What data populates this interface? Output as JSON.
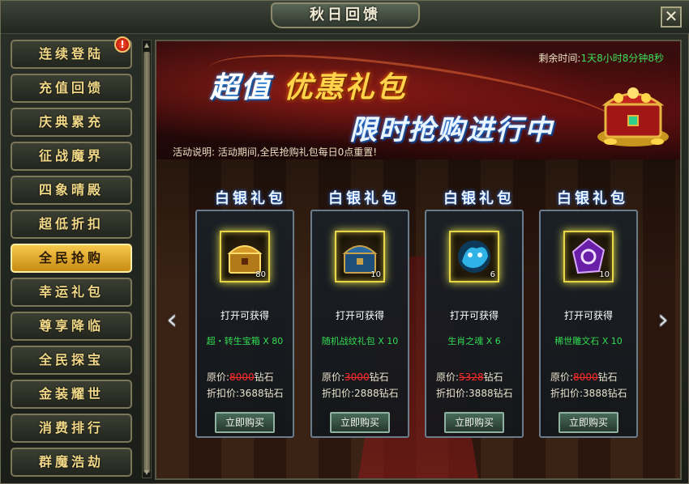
{
  "window": {
    "title": "秋日回馈",
    "close_glyph": "✕"
  },
  "sidebar": {
    "items": [
      {
        "label": "连续登陆",
        "active": false,
        "badge": "!"
      },
      {
        "label": "充值回馈",
        "active": false
      },
      {
        "label": "庆典累充",
        "active": false
      },
      {
        "label": "征战魔界",
        "active": false
      },
      {
        "label": "四象晴殿",
        "active": false
      },
      {
        "label": "超低折扣",
        "active": false
      },
      {
        "label": "全民抢购",
        "active": true
      },
      {
        "label": "幸运礼包",
        "active": false
      },
      {
        "label": "尊享降临",
        "active": false
      },
      {
        "label": "全民探宝",
        "active": false
      },
      {
        "label": "金装耀世",
        "active": false
      },
      {
        "label": "消费排行",
        "active": false
      },
      {
        "label": "群魔浩劫",
        "active": false
      }
    ]
  },
  "banner": {
    "remaining_label": "剩余时间:",
    "remaining_value": "1天8小时8分钟8秒",
    "headline_a": "超值",
    "headline_b": "优惠礼包",
    "headline_2": "限时抢购进行中",
    "desc": "活动说明: 活动期间,全民抢购礼包每日0点重置!"
  },
  "cards": [
    {
      "title": "白银礼包",
      "icon": "golden-chest-icon",
      "count": "80",
      "open_label": "打开可获得",
      "reward": "超・转生宝箱 X 80",
      "orig_label": "原价:",
      "orig_value": "8000",
      "orig_unit": "钻石",
      "disc_label": "折扣价:",
      "disc_value": "3688钻石",
      "buy": "立即购买"
    },
    {
      "title": "白银礼包",
      "icon": "blue-chest-icon",
      "count": "10",
      "open_label": "打开可获得",
      "reward": "随机战纹礼包 X 10",
      "orig_label": "原价:",
      "orig_value": "3000",
      "orig_unit": "钻石",
      "disc_label": "折扣价:",
      "disc_value": "2888钻石",
      "buy": "立即购买"
    },
    {
      "title": "白银礼包",
      "icon": "zodiac-soul-icon",
      "count": "6",
      "open_label": "打开可获得",
      "reward": "生肖之魂 X 6",
      "orig_label": "原价:",
      "orig_value": "5328",
      "orig_unit": "钻石",
      "disc_label": "折扣价:",
      "disc_value": "3888钻石",
      "buy": "立即购买"
    },
    {
      "title": "白银礼包",
      "icon": "rune-stone-icon",
      "count": "10",
      "open_label": "打开可获得",
      "reward": "稀世雕文石 X 10",
      "orig_label": "原价:",
      "orig_value": "8000",
      "orig_unit": "钻石",
      "disc_label": "折扣价:",
      "disc_value": "3888钻石",
      "buy": "立即购买"
    }
  ],
  "nav": {
    "prev_glyph": "‹",
    "next_glyph": "›"
  },
  "colors": {
    "active_tab": "#f6c84b",
    "reward_text": "#32dc52",
    "remaining_time": "#3ce05a",
    "strike_price": "#ff2b2b"
  }
}
